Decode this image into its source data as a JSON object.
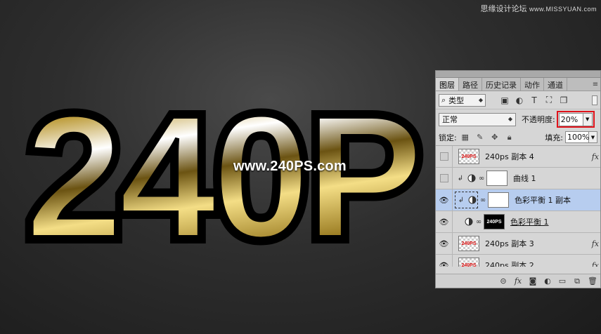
{
  "watermark": {
    "top_cn": "思缘设计论坛",
    "top_url": "www.MISSYUAN.com",
    "site": "www.240PS.com"
  },
  "panel": {
    "tabs": [
      {
        "label": "图层",
        "active": true
      },
      {
        "label": "路径",
        "active": false
      },
      {
        "label": "历史记录",
        "active": false
      },
      {
        "label": "动作",
        "active": false
      },
      {
        "label": "通道",
        "active": false
      }
    ],
    "filter": {
      "label": "类型"
    },
    "blend_mode": "正常",
    "opacity_label": "不透明度:",
    "opacity_value": "20%",
    "lock_label": "锁定:",
    "fill_label": "填充:",
    "fill_value": "100%",
    "layers": [
      {
        "name": "240ps 副本 4",
        "visible": false,
        "thumb_text": "240PS",
        "fx": "fx"
      },
      {
        "name": "曲线 1",
        "visible": false
      },
      {
        "name": "色彩平衡 1 副本",
        "visible": true,
        "selected": true
      },
      {
        "name": "色彩平衡 1",
        "visible": true,
        "mask_text": "240PS"
      },
      {
        "name": "240ps 副本 3",
        "visible": true,
        "thumb_text": "240PS",
        "fx": "fx"
      },
      {
        "name": "240ps 副本 2",
        "visible": true,
        "thumb_text": "240PS",
        "fx": "fx"
      }
    ]
  },
  "artwork": {
    "text": "240P"
  },
  "colors": {
    "highlight": "#e0121a",
    "selected_row": "#b7cdef",
    "gold": "#d4a417"
  }
}
